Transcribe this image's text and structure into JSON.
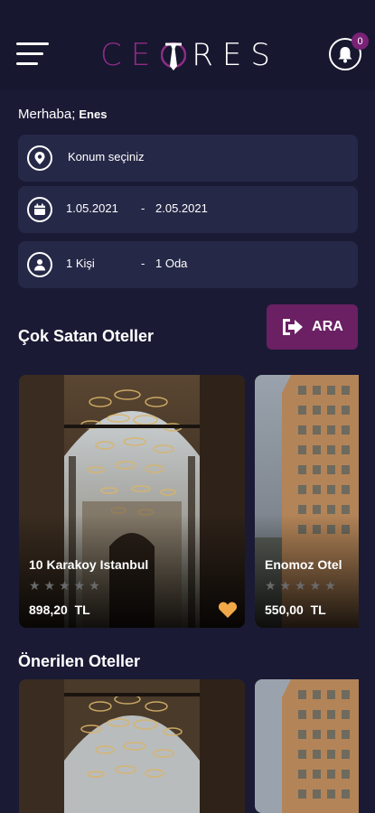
{
  "header": {
    "logo_left": "CE",
    "logo_right": "RES",
    "notification_count": "0"
  },
  "greeting": {
    "label": "Merhaba;",
    "name": "Enes"
  },
  "search": {
    "location_placeholder": "Konum seçiniz",
    "date_start": "1.05.2021",
    "date_separator": "-",
    "date_end": "2.05.2021",
    "guests": "1 Kişi",
    "guests_separator": "-",
    "rooms": "1 Oda",
    "search_button": "ARA"
  },
  "sections": {
    "best_selling": "Çok Satan Oteller",
    "recommended": "Önerilen Oteller"
  },
  "best_selling_hotels": [
    {
      "name": "10 Karakoy Istanbul",
      "stars": "★★★★★",
      "price": "898,20",
      "currency": "TL",
      "rating": 0,
      "favorite": true
    },
    {
      "name": "Enomoz Otel",
      "stars": "★★★★★",
      "price": "550,00",
      "currency": "TL",
      "rating": 0,
      "favorite": false
    }
  ],
  "colors": {
    "background": "#1a1a35",
    "accent": "#6a2063",
    "field": "#262847",
    "heart": "#f0a848"
  }
}
